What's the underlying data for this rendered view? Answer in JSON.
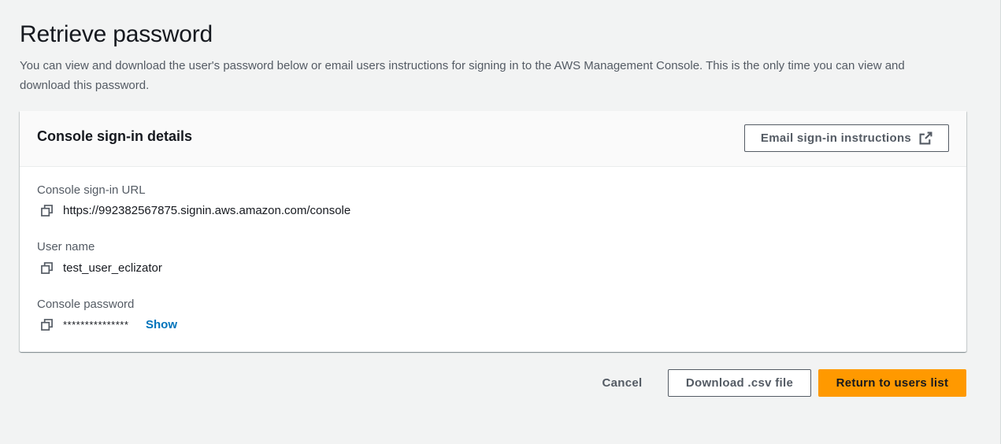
{
  "page": {
    "title": "Retrieve password",
    "description": "You can view and download the user's password below or email users instructions for signing in to the AWS Management Console. This is the only time you can view and download this password."
  },
  "panel": {
    "title": "Console sign-in details",
    "email_button_label": "Email sign-in instructions",
    "email_button_icon": "external-link-icon",
    "fields": {
      "url_label": "Console sign-in URL",
      "url_value": "https://992382567875.signin.aws.amazon.com/console",
      "username_label": "User name",
      "username_value": "test_user_eclizator",
      "password_label": "Console password",
      "password_value": "***************",
      "show_label": "Show"
    },
    "copy_icon": "copy-icon"
  },
  "footer": {
    "cancel_label": "Cancel",
    "download_label": "Download .csv file",
    "return_label": "Return to users list"
  },
  "colors": {
    "background": "#f2f3f3",
    "primary": "#ff9900",
    "link": "#0073bb",
    "text": "#16191f",
    "secondary_text": "#545b64"
  }
}
